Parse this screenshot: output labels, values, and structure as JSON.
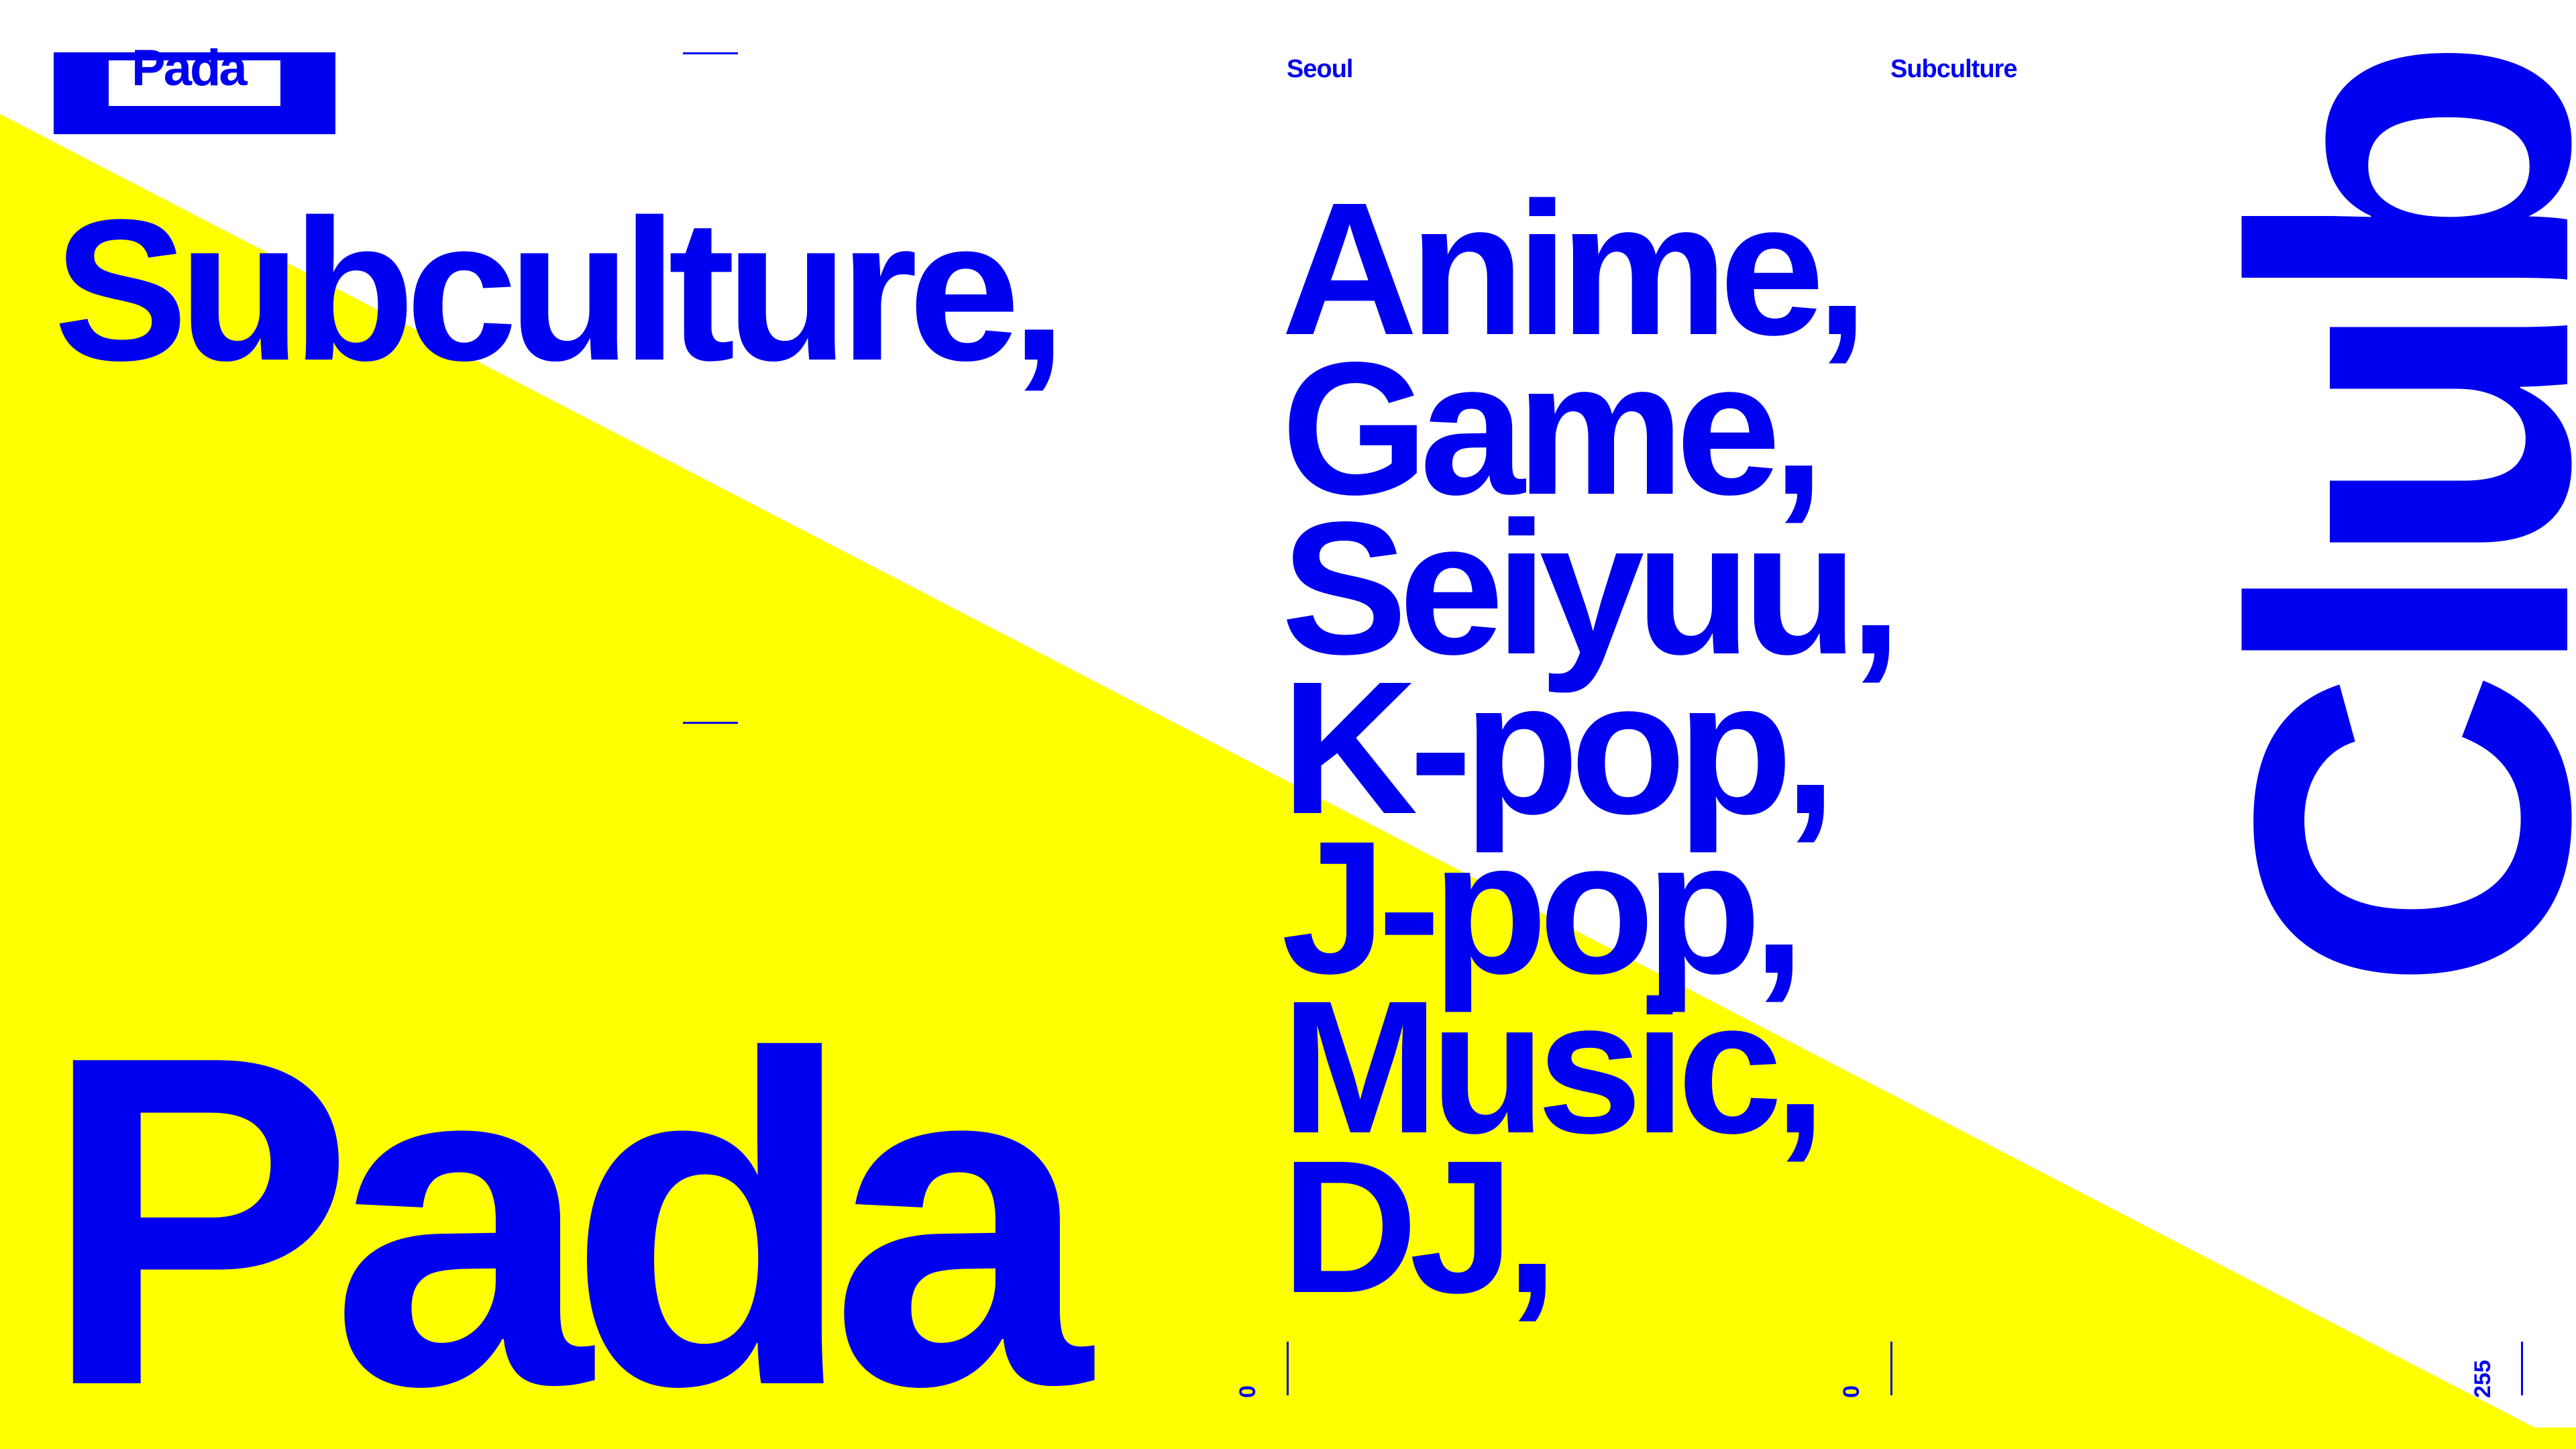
{
  "colors": {
    "background": "#ffffff",
    "accent_fill": "#ffff00",
    "text": "#0000f0"
  },
  "logo": {
    "label": "Pada"
  },
  "header": {
    "city": "Seoul",
    "category": "Subculture"
  },
  "headline": "Subculture,",
  "topics": [
    "Anime,",
    "Game,",
    "Seiyuu,",
    "K-pop,",
    "J-pop,",
    "Music,",
    "DJ,"
  ],
  "brand_big": "Pada",
  "club_label": "Club",
  "markers": {
    "left": "0",
    "middle": "0",
    "right": "255"
  }
}
